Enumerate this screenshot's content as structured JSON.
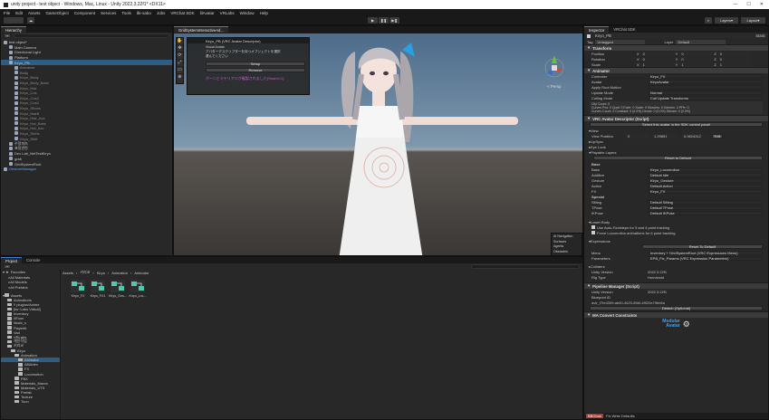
{
  "window": {
    "title": "unity project - test object - Windows, Mac, Linux - Unity 2022.3.22f1* <DX11>",
    "min": "—",
    "max": "☐",
    "close": "✕"
  },
  "menu": [
    "File",
    "Edit",
    "Assets",
    "GameObject",
    "Component",
    "Services",
    "Tools",
    "åk-sabo",
    "Jobs",
    "VRChat SDK",
    "lilAvatar",
    "VRLabs",
    "Window",
    "Help"
  ],
  "toolbar": {
    "layers": "Layers",
    "layout": "Layout",
    "play": "▶",
    "pause": "❚❚",
    "step": "▶❚"
  },
  "hierarchy": {
    "tab": "Hierarchy",
    "items": [
      {
        "label": "test object*",
        "depth": 0
      },
      {
        "label": "Main Camera",
        "depth": 1
      },
      {
        "label": "Directional Light",
        "depth": 1
      },
      {
        "label": "Platform",
        "depth": 1
      },
      {
        "label": "Kiryo_PB",
        "depth": 1
      },
      {
        "label": "Armature",
        "depth": 2
      },
      {
        "label": "Body",
        "depth": 2
      },
      {
        "label": "Kiryo_Body",
        "depth": 2
      },
      {
        "label": "Kiryo_Body_Base",
        "depth": 2
      },
      {
        "label": "Kiryo_Hair",
        "depth": 2
      },
      {
        "label": "Kiryo_Cos",
        "depth": 2
      },
      {
        "label": "Kiryo_Cos2",
        "depth": 2
      },
      {
        "label": "Kiryo_Cos3",
        "depth": 2
      },
      {
        "label": "Kiryo_Shoes",
        "depth": 2
      },
      {
        "label": "Kiryo_HairB",
        "depth": 2
      },
      {
        "label": "Kiryo_Hair_Acc",
        "depth": 2
      },
      {
        "label": "Kiryo_Hat_Base",
        "depth": 2
      },
      {
        "label": "Kiryo_Hat_Acc",
        "depth": 2
      },
      {
        "label": "Kiryo_Shirts",
        "depth": 2
      },
      {
        "label": "Kiryo_Skirt",
        "depth": 2
      },
      {
        "label": "수정파츠",
        "depth": 1
      },
      {
        "label": "표정관련",
        "depth": 1
      },
      {
        "label": "Dev Lab_NetTestKiryo",
        "depth": 1
      },
      {
        "label": "grab",
        "depth": 1
      },
      {
        "label": "GridSystemRoot",
        "depth": 1
      },
      {
        "label": "GestureManager",
        "depth": 0
      }
    ]
  },
  "scene": {
    "tab": "GridSystemInteractiveAd...",
    "overlay_title": "Kiryo_PB (VRC Avatar Descriptor)",
    "overlay_lines": [
      "Visual Avatar",
      "アバターデスクリプターを持つオブジェクトを選択",
      "選んでください"
    ],
    "overlay_buttons": [
      "Setup",
      "Remove"
    ],
    "overlay_warning": "ボーンとマテリアルが複製されました(Search:1)",
    "persp": "< Persp",
    "nav": [
      "AI Navigation",
      "Surfaces",
      "Agents",
      "Obstacles"
    ]
  },
  "inspector": {
    "tabs": [
      "Inspector",
      "VRChat SDK"
    ],
    "object_name": "Kiryo_PB",
    "static": "Static",
    "tag_label": "Tag",
    "tag": "Untagged",
    "layer_label": "Layer",
    "layer": "Default",
    "transform": {
      "title": "Transform",
      "rows": [
        {
          "label": "Position",
          "x": "0",
          "y": "0",
          "z": "0"
        },
        {
          "label": "Rotation",
          "x": "0",
          "y": "0",
          "z": "0"
        },
        {
          "label": "Scale",
          "x": "1",
          "y": "1",
          "z": "1"
        }
      ]
    },
    "animator": {
      "title": "Animator",
      "rows": [
        {
          "label": "Controller",
          "value": "Kiryo_FX"
        },
        {
          "label": "Avatar",
          "value": "KiryoAvatar"
        },
        {
          "label": "Apply Root Motion",
          "value": ""
        },
        {
          "label": "Update Mode",
          "value": "Normal"
        },
        {
          "label": "Culling Mode",
          "value": "Cull Update Transforms"
        }
      ],
      "info": "Clip Count: 0\nCurves Pos: 0 Quat: 0 Euler: 0 Scale: 0 Muscles: 0 Generic: 0 PPtr: 0\nCurves Count: 0 Constant: 0 (0.0%) Dense: 0 (0.0%) Stream: 0 (0.0%)"
    },
    "descriptor": {
      "title": "VRC Avatar Descriptor (Script)",
      "select_btn": "Select this avatar in the SDK control panel",
      "view_label": "View",
      "view_position_label": "View Position",
      "vx": "0",
      "vy": "1.29891",
      "vz": "0.0824312",
      "edit": "Edit",
      "lipsync": "LipSync",
      "eyelook": "Eye Look",
      "playable": "Playable Layers",
      "reset": "Reset to Default",
      "base_label": "Base",
      "base_rows": [
        {
          "label": "Base",
          "value": "Kiryo_Locomotion"
        },
        {
          "label": "Additive",
          "value": "Default Idle"
        },
        {
          "label": "Gesture",
          "value": "Kiryo_Gesture"
        },
        {
          "label": "Action",
          "value": "Default Action"
        },
        {
          "label": "FX",
          "value": "Kiryo_FX"
        }
      ],
      "special_label": "Special",
      "special_rows": [
        {
          "label": "Sitting",
          "value": "Default Sitting"
        },
        {
          "label": "TPose",
          "value": "Default TPose"
        },
        {
          "label": "IKPose",
          "value": "Default IKPose"
        }
      ],
      "lower_body": "Lower Body",
      "lb_opt1": "Use Auto-Footsteps for 3 and 4 point tracking",
      "lb_opt2": "Force Locomotion animations for 6 point tracking",
      "expressions": "Expressions",
      "exp_reset": "Reset To Default",
      "menu_label": "Menu",
      "menu_value": "Inventory + GridSystemRoot (VRC Expressions Menu)",
      "params_label": "Parameters",
      "params_value": "EPB_Fix_Params (VRC Expression Parameters)",
      "colliders": "Colliders",
      "unity_version_label": "Unity Version",
      "unity_version": "2022.3.22f1",
      "rig_label": "Rig Type",
      "rig": "Humanoid"
    },
    "pipeline": {
      "title": "Pipeline Manager (Script)",
      "bp_label": "Unity Version",
      "bp_value": "2022.3.22f1",
      "blueprint_label": "Blueprint ID",
      "blueprint": "avtr_f7fe4359-ab60-4623-85bf-4f920e79bb6a",
      "detach": "Detach (Optional)"
    },
    "ma": {
      "title": "MA Convert Constraints",
      "logo_top": "Modular",
      "logo_bottom": "Avatar"
    },
    "bottom_tabs": [
      "BBOmm",
      "Fix Write Defaults"
    ]
  },
  "project": {
    "tabs": [
      "Project",
      "Console"
    ],
    "favorites": "Favorites",
    "fav_items": [
      "All Materials",
      "All Models",
      "All Prefabs"
    ],
    "assets": "Assets",
    "tree": [
      "Animations",
      "!! plugins/Anime",
      "[ks~Labs Virtual]",
      "Inventory",
      "lilToon",
      "lilcalc_s",
      "Playerlit",
      "Vad",
      "VRLabs",
      "개인작업",
      "키리코",
      "Kiryo",
      "Animation",
      "Animator",
      "AlltAnim",
      "FX",
      "Locomotion",
      "FBX",
      "Materials_Maxxx",
      "Materials_UTS",
      "Prefab",
      "Texture",
      "Toon"
    ],
    "breadcrumb": [
      "Assets",
      "키리코",
      "Kiryo",
      "Animation",
      "Animator"
    ],
    "files": [
      "Kiryo_FX",
      "Kiryo_FX1",
      "Kiryo_Ges...",
      "Kiryo_Loc..."
    ]
  },
  "colors": {
    "accent": "#3d7ed8",
    "warning": "#d44fd4",
    "panel": "#282828",
    "bg": "#191919"
  }
}
